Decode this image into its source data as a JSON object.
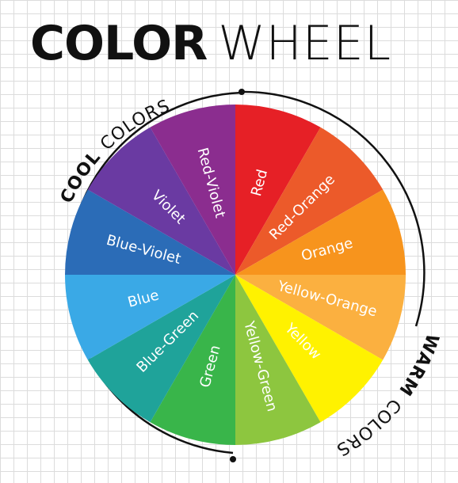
{
  "title": {
    "bold": "COLOR",
    "light": "WHEEL"
  },
  "cool_label": {
    "bold": "COOL",
    "light": "COLORS"
  },
  "warm_label": {
    "bold": "WARM",
    "light": "COLORS"
  },
  "segments": [
    {
      "name": "Red",
      "color": "#e62026"
    },
    {
      "name": "Red-Orange",
      "color": "#ec5a2a"
    },
    {
      "name": "Orange",
      "color": "#f7941d"
    },
    {
      "name": "Yellow-Orange",
      "color": "#fbb040"
    },
    {
      "name": "Yellow",
      "color": "#fff200"
    },
    {
      "name": "Yellow-Green",
      "color": "#8dc63f"
    },
    {
      "name": "Green",
      "color": "#39b54a"
    },
    {
      "name": "Blue-Green",
      "color": "#1fa39a"
    },
    {
      "name": "Blue",
      "color": "#3aa9e6"
    },
    {
      "name": "Blue-Violet",
      "color": "#2b6cb7"
    },
    {
      "name": "Violet",
      "color": "#6a3aa2"
    },
    {
      "name": "Red-Violet",
      "color": "#8b2d8f"
    }
  ]
}
